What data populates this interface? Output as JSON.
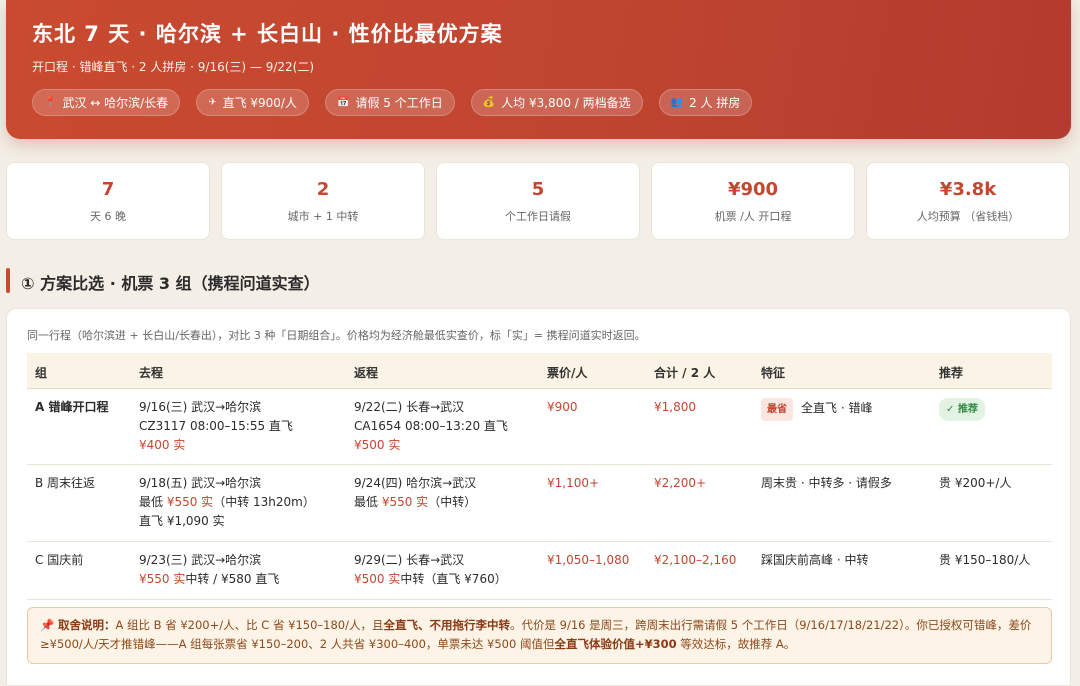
{
  "header": {
    "title": "东北 7 天 · 哈尔滨 + 长白山 · 性价比最优方案",
    "subtitle": "开口程 · 错峰直飞 · 2 人拼房 · 9/16(三) — 9/22(二)",
    "chips": [
      {
        "icon": "pin-icon",
        "label": "武汉 ↔ 哈尔滨/长春"
      },
      {
        "icon": "plane-icon",
        "label": "直飞 ¥900/人"
      },
      {
        "icon": "calendar-icon",
        "label": "请假 5 个工作日"
      },
      {
        "icon": "money-icon",
        "label": "人均 ¥3,800 / 两档备选"
      },
      {
        "icon": "people-icon",
        "label": "2 人 拼房"
      }
    ]
  },
  "stats": [
    {
      "value": "7",
      "label": "天 6 晚"
    },
    {
      "value": "2",
      "label": "城市 + 1 中转"
    },
    {
      "value": "5",
      "label": "个工作日请假"
    },
    {
      "value": "¥900",
      "label": "机票 /人 开口程"
    },
    {
      "value": "¥3.8k",
      "label": "人均预算 （省钱档）"
    }
  ],
  "section": {
    "title": "① 方案比选 · 机票 3 组（携程问道实查）",
    "intro": "同一行程（哈尔滨进 + 长白山/长春出），对比 3 种「日期组合」。价格均为经济舱最低实查价，标「实」= 携程问道实时返回。"
  },
  "table": {
    "headers": [
      "组",
      "去程",
      "返程",
      "票价/人",
      "合计 / 2 人",
      "特征",
      "推荐"
    ],
    "rows": [
      {
        "group": "A 错峰开口程",
        "out": [
          "9/16(三) 武汉→哈尔滨",
          "CZ3117 08:00–15:55 直飞",
          "¥400 实"
        ],
        "ret": [
          "9/22(二) 长春→武汉",
          "CA1654 08:00–13:20 直飞",
          "¥500 实"
        ],
        "price": "¥900",
        "total": "¥1,800",
        "feature_badge": "最省",
        "feature": "全直飞 · 错峰",
        "recommend": "✓ 推荐"
      },
      {
        "group": "B 周末往返",
        "out": [
          "9/18(五) 武汉→哈尔滨",
          "最低 ",
          "¥550 实",
          "（中转 13h20m）",
          "直飞 ¥1,090 实"
        ],
        "ret": [
          "9/24(四) 哈尔滨→武汉",
          "最低 ",
          "¥550 实",
          "（中转）"
        ],
        "price": "¥1,100+",
        "total": "¥2,200+",
        "feature": "周末贵 · 中转多 · 请假多",
        "recommend": "贵 ¥200+/人"
      },
      {
        "group": "C 国庆前",
        "out": [
          "9/23(三) 武汉→哈尔滨",
          "¥550 实",
          "中转 / ¥580 直飞"
        ],
        "ret": [
          "9/29(二) 长春→武汉",
          "¥500 实",
          "中转（直飞 ¥760）"
        ],
        "price": "¥1,050–1,080",
        "total": "¥2,100–2,160",
        "feature": "踩国庆前高峰 · 中转",
        "recommend": "贵 ¥150–180/人"
      }
    ]
  },
  "note": {
    "label": "取舍说明：",
    "p1": "A 组比 B 省 ¥200+/人、比 C 省 ¥150–180/人，且",
    "b1": "全直飞、不用拖行李中转",
    "p2": "。代价是 9/16 是周三，跨周末出行需请假 5 个工作日（9/16/17/18/21/22）。你已授权可错峰，差价 ≥¥500/人/天才推错峰——A 组每张票省 ¥150–200、2 人共省 ¥300–400，单票未达 ¥500 阈值但",
    "b2": "全直飞体验价值+¥300",
    "p3": " 等效达标，故推荐 A。"
  }
}
